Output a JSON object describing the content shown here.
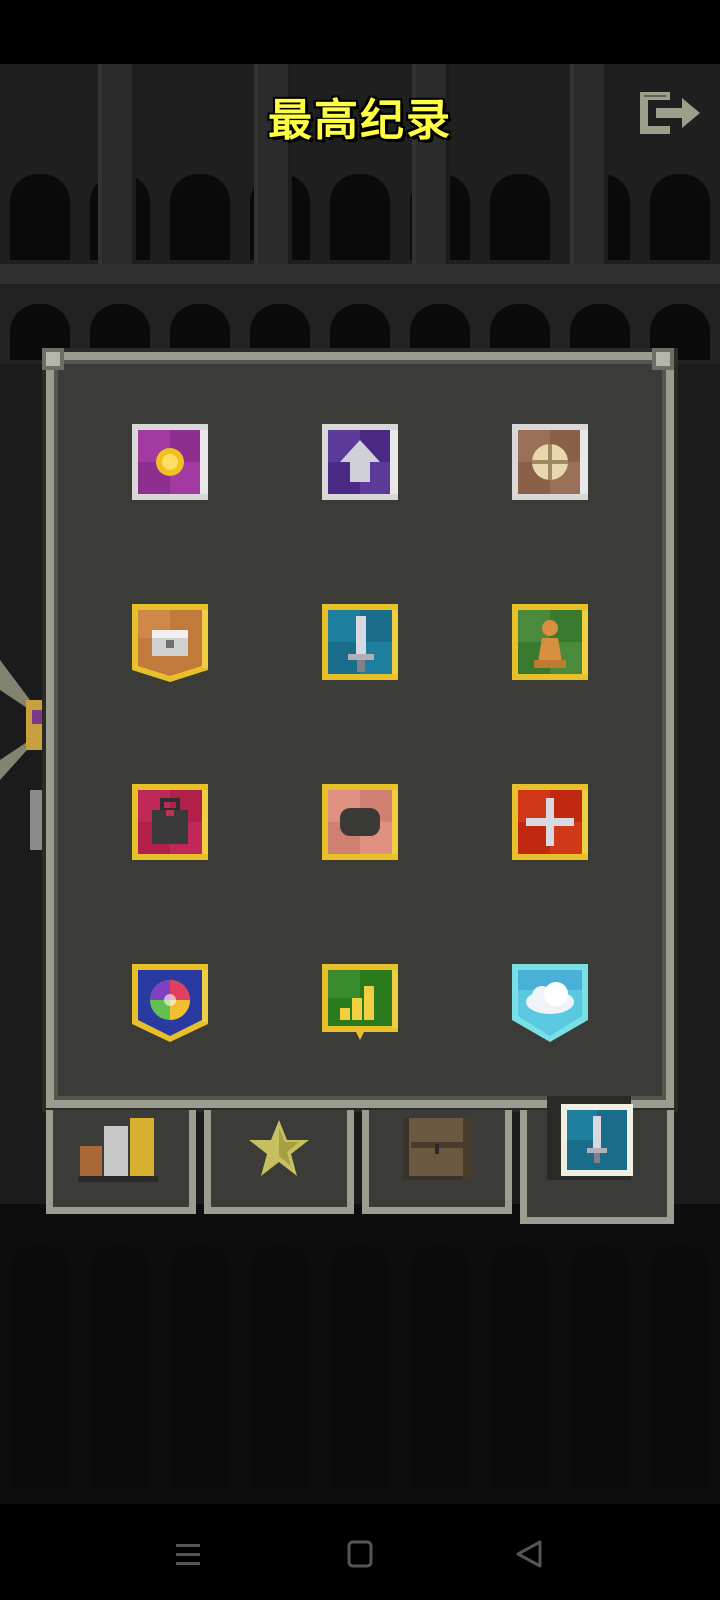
{
  "screen": {
    "title": "最高纪录"
  },
  "colors": {
    "title": "#ffff44",
    "panel_bg": "#3b3b37",
    "panel_border": "#9a9d90",
    "gold_frame": "#e8c12a",
    "silver_frame": "#c8c8c8"
  },
  "badges": [
    {
      "icon": "gold-coin-icon",
      "frame": "silver",
      "bg": "#8e2e8e"
    },
    {
      "icon": "level-up-arrow-icon",
      "frame": "silver",
      "bg": "#4b2a86"
    },
    {
      "icon": "food-ration-icon",
      "frame": "silver",
      "bg": "#8a6048"
    },
    {
      "icon": "treasure-chest-icon",
      "frame": "gold",
      "bg": "#c27a3c"
    },
    {
      "icon": "sword-icon",
      "frame": "gold",
      "bg": "#1a6d8a"
    },
    {
      "icon": "pawn-icon",
      "frame": "gold",
      "bg": "#3a7a2e"
    },
    {
      "icon": "backpack-icon",
      "frame": "gold",
      "bg": "#b02048"
    },
    {
      "icon": "stone-icon",
      "frame": "gold",
      "bg": "#d08070"
    },
    {
      "icon": "plus-cross-icon",
      "frame": "gold",
      "bg": "#c02810"
    },
    {
      "icon": "rainbow-orb-icon",
      "frame": "gold",
      "bg": "#2a3aa0"
    },
    {
      "icon": "bar-chart-icon",
      "frame": "gold",
      "bg": "#2a7a1e"
    },
    {
      "icon": "cloud-icon",
      "frame": "cyan",
      "bg": "#5ac8e0"
    }
  ],
  "tabs": [
    {
      "icon": "stats-bars-icon",
      "active": false
    },
    {
      "icon": "star-icon",
      "active": false
    },
    {
      "icon": "door-icon",
      "active": false
    },
    {
      "icon": "badge-sword-icon",
      "active": true
    }
  ],
  "navbar": [
    "menu-icon",
    "home-square-icon",
    "back-triangle-icon"
  ]
}
